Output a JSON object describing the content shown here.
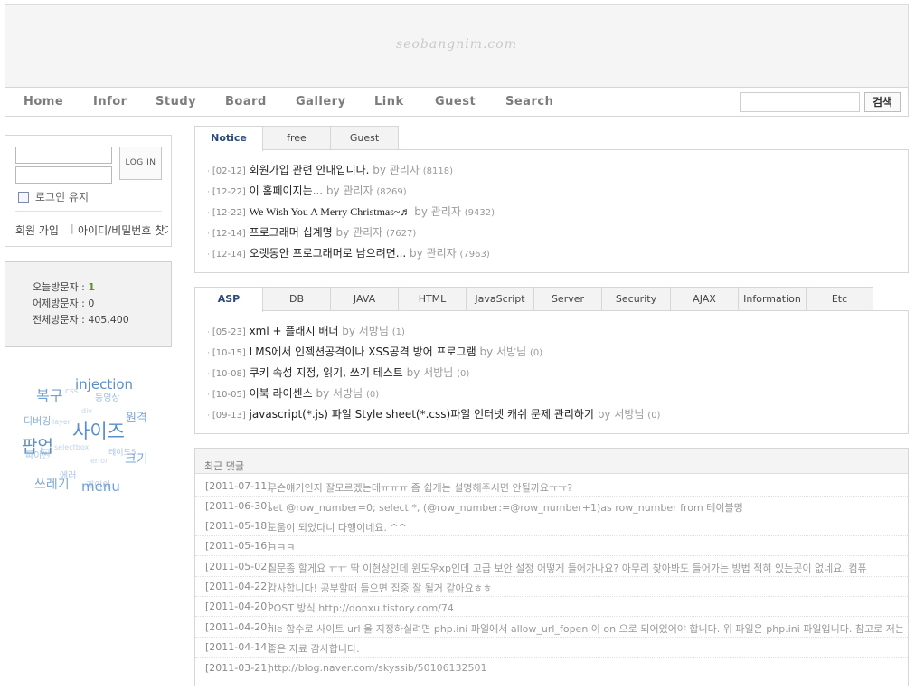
{
  "header": {
    "logo": "seobangnim.com"
  },
  "nav": {
    "items": [
      {
        "label": "Home"
      },
      {
        "label": "Infor"
      },
      {
        "label": "Study"
      },
      {
        "label": "Board"
      },
      {
        "label": "Gallery"
      },
      {
        "label": "Link"
      },
      {
        "label": "Guest"
      },
      {
        "label": "Search"
      }
    ],
    "search_placeholder": "",
    "search_button": "검색"
  },
  "login": {
    "button": "LOG IN",
    "keep_label": "로그인 유지",
    "join": "회원 가입",
    "separator": "|",
    "find": "아이디/비밀번호 찾기"
  },
  "visitors": {
    "today_label": "오늘방문자 : ",
    "today_value": "1",
    "yesterday_label": "어제방문자 : ",
    "yesterday_value": "0",
    "total_label": "전체방문자 : ",
    "total_value": "405,400"
  },
  "tags": [
    {
      "text": "복구"
    },
    {
      "text": "css"
    },
    {
      "text": "injection"
    },
    {
      "text": "동영상"
    },
    {
      "text": "div"
    },
    {
      "text": "디버깅"
    },
    {
      "text": "layer"
    },
    {
      "text": "사이즈"
    },
    {
      "text": "원격"
    },
    {
      "text": "팝업"
    },
    {
      "text": "selectbox"
    },
    {
      "text": "레이드5"
    },
    {
      "text": "파이썬"
    },
    {
      "text": "크기"
    },
    {
      "text": "error"
    },
    {
      "text": "에러"
    },
    {
      "text": "쓰레기"
    },
    {
      "text": "레이아"
    },
    {
      "text": "menu"
    }
  ],
  "board1": {
    "tabs": [
      {
        "label": "Notice"
      },
      {
        "label": "free"
      },
      {
        "label": "Guest"
      }
    ],
    "posts": [
      {
        "date": "[02-12]",
        "title": "회원가입 관련 안내입니다.",
        "by": "by 관리자",
        "count": "(8118)"
      },
      {
        "date": "[12-22]",
        "title": "이 홈페이지는...",
        "by": "by 관리자",
        "count": "(8269)"
      },
      {
        "date": "[12-22]",
        "title": "We Wish You A Merry Christmas~♬",
        "by": "by 관리자",
        "count": "(9432)"
      },
      {
        "date": "[12-14]",
        "title": "프로그래머 십계명",
        "by": "by 관리자",
        "count": "(7627)"
      },
      {
        "date": "[12-14]",
        "title": "오랫동안 프로그래머로 남으려면...",
        "by": "by 관리자",
        "count": "(7963)"
      }
    ]
  },
  "board2": {
    "tabs": [
      {
        "label": "ASP"
      },
      {
        "label": "DB"
      },
      {
        "label": "JAVA"
      },
      {
        "label": "HTML"
      },
      {
        "label": "JavaScript"
      },
      {
        "label": "Server"
      },
      {
        "label": "Security"
      },
      {
        "label": "AJAX"
      },
      {
        "label": "Information"
      },
      {
        "label": "Etc"
      }
    ],
    "posts": [
      {
        "date": "[05-23]",
        "title": "xml + 플래시 배너",
        "by": "by 서방님",
        "count": "(1)"
      },
      {
        "date": "[10-15]",
        "title": "LMS에서 인젝션공격이나 XSS공격 방어 프로그램",
        "by": "by 서방님",
        "count": "(0)"
      },
      {
        "date": "[10-08]",
        "title": "쿠키 속성 지정, 읽기, 쓰기 테스트",
        "by": "by 서방님",
        "count": "(0)"
      },
      {
        "date": "[10-05]",
        "title": "이북 라이센스",
        "by": "by 서방님",
        "count": "(0)"
      },
      {
        "date": "[09-13]",
        "title": "javascript(*.js) 파일 Style sheet(*.css)파일 인터넷 캐쉬 문제 관리하기",
        "by": "by 서방님",
        "count": "(0)"
      }
    ]
  },
  "comments": {
    "title": "최근 댓글",
    "items": [
      {
        "date": "[2011-07-11]",
        "text": "무슨얘기인지 잘모르겠는데ㅠㅠㅠ 좀 쉽게는 설명해주시면 안될까요ㅠㅠ?"
      },
      {
        "date": "[2011-06-30]",
        "text": "set @row_number=0; select *, (@row_number:=@row_number+1)as row_number from 테이블명"
      },
      {
        "date": "[2011-05-18]",
        "text": "도움이 되었다니 다행이네요. ^^"
      },
      {
        "date": "[2011-05-16]",
        "text": "ㅋㅋㅋ"
      },
      {
        "date": "[2011-05-02]",
        "text": "질문좀 할게요 ㅠㅠ 딱 이현상인데 윈도우xp인데 고급 보안 설정 어떻게 들어가나요? 아무리 찾아봐도 들어가는 방법 적혀 있는곳이 없네요. 컴퓨"
      },
      {
        "date": "[2011-04-22]",
        "text": "감사합니다! 공부할때 들으면 집중 잘 될거 같아요ㅎㅎ"
      },
      {
        "date": "[2011-04-20]",
        "text": "POST 방식 http://donxu.tistory.com/74"
      },
      {
        "date": "[2011-04-20]",
        "text": "file 함수로 사이트 url 을 지정하실려면 php.ini 파일에서 allow_url_fopen 이 on 으로 되어있어야 합니다. 위 파일은 php.ini 파일입니다. 참고로 저는"
      },
      {
        "date": "[2011-04-14]",
        "text": "좋은 자료 감사합니다."
      },
      {
        "date": "[2011-03-21]",
        "text": "http://blog.naver.com/skyssib/50106132501"
      }
    ]
  },
  "colors": {
    "active_tab": "#2a4a78",
    "today_visitor": "#5a8f1e",
    "tag_blue": "#5b8fc9"
  }
}
